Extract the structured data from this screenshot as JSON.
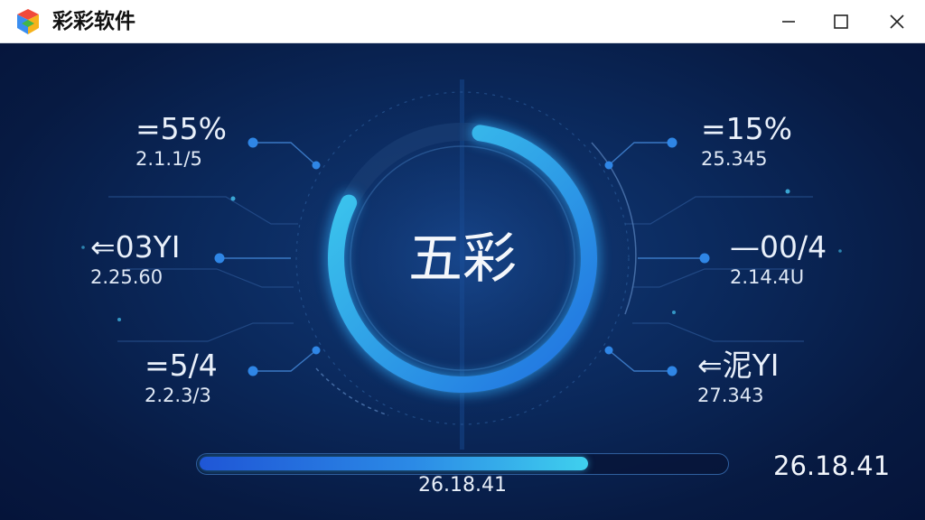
{
  "window": {
    "title": "彩彩软件",
    "controls": {
      "minimize_icon": "minimize-icon",
      "maximize_icon": "maximize-icon",
      "close_icon": "close-icon"
    }
  },
  "dashboard": {
    "center_label": "五彩",
    "ring_progress": 0.8,
    "metrics_left": [
      {
        "value": "=55%",
        "sub": "2.1.1/5"
      },
      {
        "value": "⇐03YI",
        "sub": "2.25.60"
      },
      {
        "value": "=5/4",
        "sub": "2.2.3/3"
      }
    ],
    "metrics_right": [
      {
        "value": "=15%",
        "sub": "25.345"
      },
      {
        "value": "—00/4",
        "sub": "2.14.4U"
      },
      {
        "value": "⇐泥YI",
        "sub": "27.343"
      }
    ],
    "progress": {
      "value": 0.74,
      "label": "26.18.41"
    },
    "time_readout": "26.18.41"
  },
  "colors": {
    "background": "#0a1e45",
    "ring_accent": "#2f8fe8",
    "ring_highlight": "#3fd0ee",
    "titlebar": "#ffffff"
  }
}
